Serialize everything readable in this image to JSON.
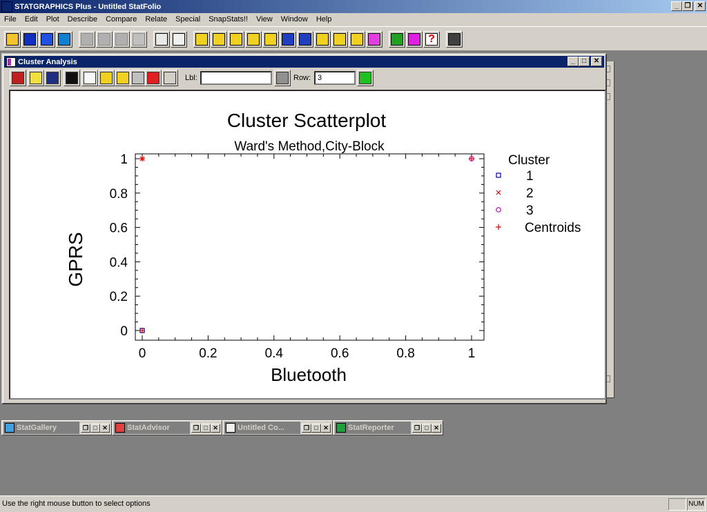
{
  "app": {
    "title": "STATGRAPHICS Plus - Untitled StatFolio",
    "window_buttons": [
      "_",
      "❐",
      "✕"
    ]
  },
  "menu": {
    "items": [
      "File",
      "Edit",
      "Plot",
      "Describe",
      "Compare",
      "Relate",
      "Special",
      "SnapStats!!",
      "View",
      "Window",
      "Help"
    ]
  },
  "toolbar": {
    "icons": [
      "open-icon",
      "save-icon",
      "calculator-grid-icon",
      "save-data-icon",
      "cut-icon",
      "copy-icon",
      "paste-icon",
      "undo-icon",
      "print-icon",
      "print-preview-icon",
      "scatter-icon",
      "boxplot-icon",
      "histogram-icon",
      "xyz-icon",
      "matrix-icon",
      "wave-icon",
      "normal-dist-icon",
      "trend-icon",
      "globe-icon",
      "step-icon",
      "glm-icon",
      "statadvisor-icon",
      "wizard-icon",
      "help-icon",
      "calculator-icon"
    ]
  },
  "child_window": {
    "title": "Cluster Analysis",
    "window_buttons": [
      "_",
      "□",
      "✕"
    ],
    "toolbar_icons": [
      "input-dialog-icon",
      "analysis-options-icon",
      "tables-icon",
      "graphs-icon",
      "save-results-icon",
      "pane-options-icon",
      "graph-options-icon",
      "exclude-icon",
      "jitter-icon",
      "identify-icon"
    ],
    "lbl_label": "Lbl:",
    "lbl_value": "",
    "row_label": "Row:",
    "row_value": "3"
  },
  "chart_data": {
    "type": "scatter",
    "title": "Cluster Scatterplot",
    "subtitle": "Ward's Method,City-Block",
    "xlabel": "Bluetooth",
    "ylabel": "GPRS",
    "xlim": [
      0,
      1
    ],
    "ylim": [
      0,
      1
    ],
    "x_ticks": [
      "0",
      "0.2",
      "0.4",
      "0.6",
      "0.8",
      "1"
    ],
    "y_ticks": [
      "0",
      "0.2",
      "0.4",
      "0.6",
      "0.8",
      "1"
    ],
    "legend_title": "Cluster",
    "legend_position": "right",
    "series": [
      {
        "name": "1",
        "marker": "square",
        "color": "#0000a0",
        "points": [
          [
            0,
            0
          ]
        ]
      },
      {
        "name": "2",
        "marker": "x",
        "color": "#e00000",
        "points": [
          [
            0,
            1
          ]
        ]
      },
      {
        "name": "3",
        "marker": "circle",
        "color": "#c000c0",
        "points": [
          [
            1,
            1
          ]
        ]
      },
      {
        "name": "Centroids",
        "marker": "plus",
        "color": "#e00000",
        "points": [
          [
            0,
            0
          ],
          [
            0,
            1
          ],
          [
            1,
            1
          ]
        ]
      }
    ]
  },
  "minimized_windows": [
    {
      "title": "StatGallery",
      "icon": "statgallery-icon"
    },
    {
      "title": "StatAdvisor",
      "icon": "statadvisor-icon"
    },
    {
      "title": "Untitled Co...",
      "icon": "comments-icon"
    },
    {
      "title": "StatReporter",
      "icon": "statreporter-icon"
    }
  ],
  "status": {
    "text": "Use the right mouse button to select options",
    "num": "NUM"
  }
}
